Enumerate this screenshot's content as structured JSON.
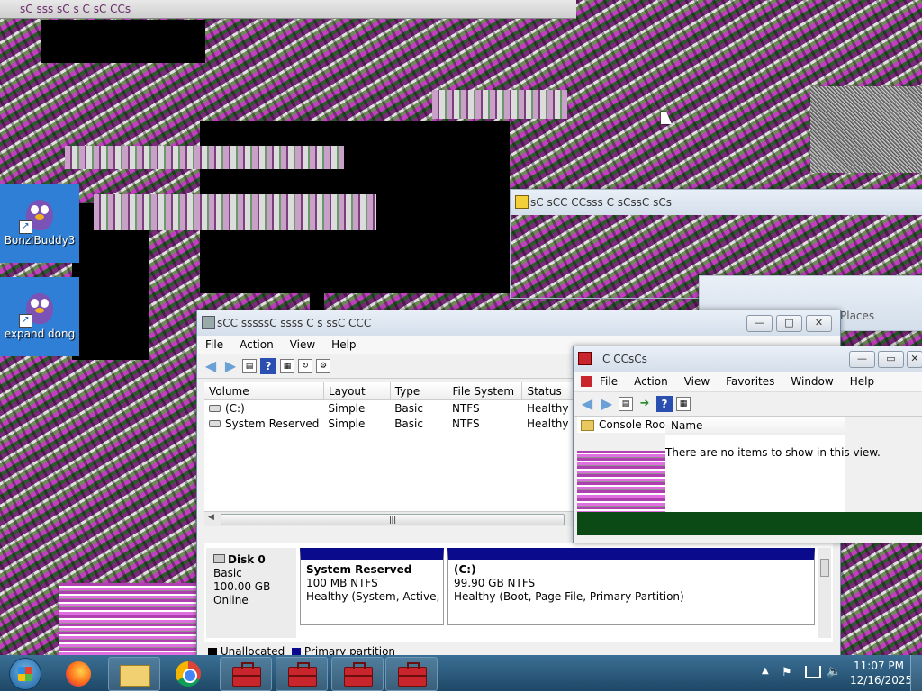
{
  "desktop": {
    "top_glitch_title": "sC sss sC  s C  sC CCs",
    "icons": [
      {
        "label": "BonziBuddy3"
      },
      {
        "label": "expand dong"
      }
    ]
  },
  "win_error": {
    "title": "sC sCC  CCsss C sCssC  sCs"
  },
  "win_places": {
    "label": "Places"
  },
  "disk_mgmt": {
    "title": "sCC sssssC ssss C s ssC CCC",
    "menu": [
      "File",
      "Action",
      "View",
      "Help"
    ],
    "columns": [
      "Volume",
      "Layout",
      "Type",
      "File System",
      "Status"
    ],
    "rows": [
      {
        "volume": "(C:)",
        "layout": "Simple",
        "type": "Basic",
        "fs": "NTFS",
        "status": "Healthy"
      },
      {
        "volume": "System Reserved",
        "layout": "Simple",
        "type": "Basic",
        "fs": "NTFS",
        "status": "Healthy"
      }
    ],
    "disk": {
      "name": "Disk 0",
      "type": "Basic",
      "size": "100.00 GB",
      "state": "Online"
    },
    "partitions": [
      {
        "name": "System Reserved",
        "size": "100 MB NTFS",
        "status": "Healthy (System, Active, Pri"
      },
      {
        "name": "(C:)",
        "size": "99.90 GB NTFS",
        "status": "Healthy (Boot, Page File, Primary Partition)"
      }
    ],
    "legend": [
      "Unallocated",
      "Primary partition"
    ],
    "colors": {
      "partition_header": "#0a0a8c",
      "legend_unallocated": "#000000",
      "legend_primary": "#0a0a8c"
    }
  },
  "mmc": {
    "title": "C CCsCs",
    "menu": [
      "File",
      "Action",
      "View",
      "Favorites",
      "Window",
      "Help"
    ],
    "tree_item": "Console Roo",
    "column_name": "Name",
    "empty_text": "There are no items to show in this view."
  },
  "taskbar": {
    "time": "11:07 PM",
    "date": "12/16/2025"
  }
}
